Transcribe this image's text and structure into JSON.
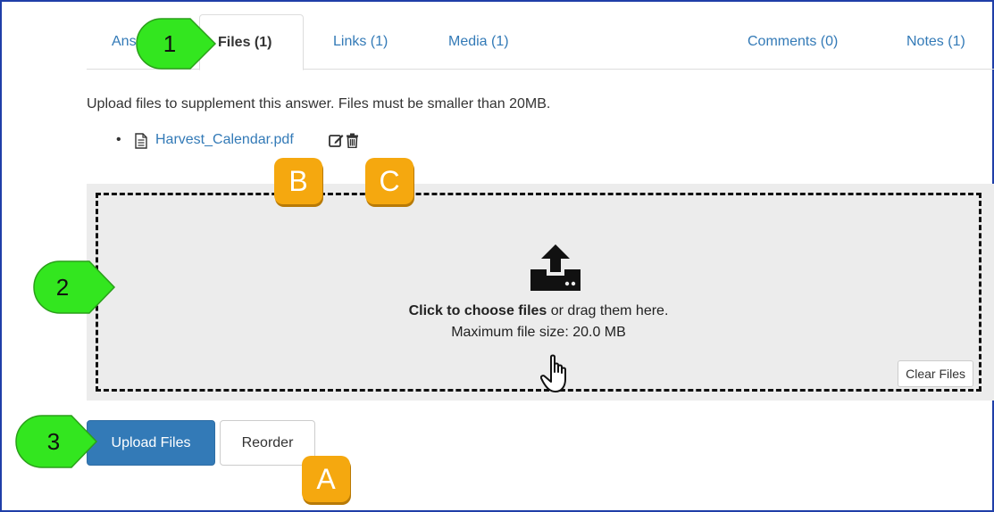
{
  "tabs": [
    {
      "label": "Ans"
    },
    {
      "label": "Files (1)",
      "active": true
    },
    {
      "label": "Links (1)"
    },
    {
      "label": "Media (1)"
    },
    {
      "label": "Comments (0)"
    },
    {
      "label": "Notes (1)"
    }
  ],
  "intro_text": "Upload files to supplement this answer. Files must be smaller than 20MB.",
  "files": [
    {
      "name": "Harvest_Calendar.pdf",
      "icon": "document-icon",
      "actions": [
        "edit-icon",
        "trash-icon"
      ]
    }
  ],
  "dropzone": {
    "cta_bold": "Click to choose files",
    "cta_rest": " or drag them here.",
    "max_size": "Maximum file size: 20.0 MB",
    "clear_label": "Clear Files",
    "icon": "upload-icon"
  },
  "buttons": {
    "upload": "Upload Files",
    "reorder": "Reorder"
  },
  "callouts": {
    "one": "1",
    "two": "2",
    "three": "3",
    "a": "A",
    "b": "B",
    "c": "C"
  },
  "colors": {
    "accent": "#337ab7",
    "callout_green": "#33e61f",
    "callout_orange": "#f5a80f",
    "frame": "#1f3fa8",
    "dropzone_bg": "#ececec"
  }
}
